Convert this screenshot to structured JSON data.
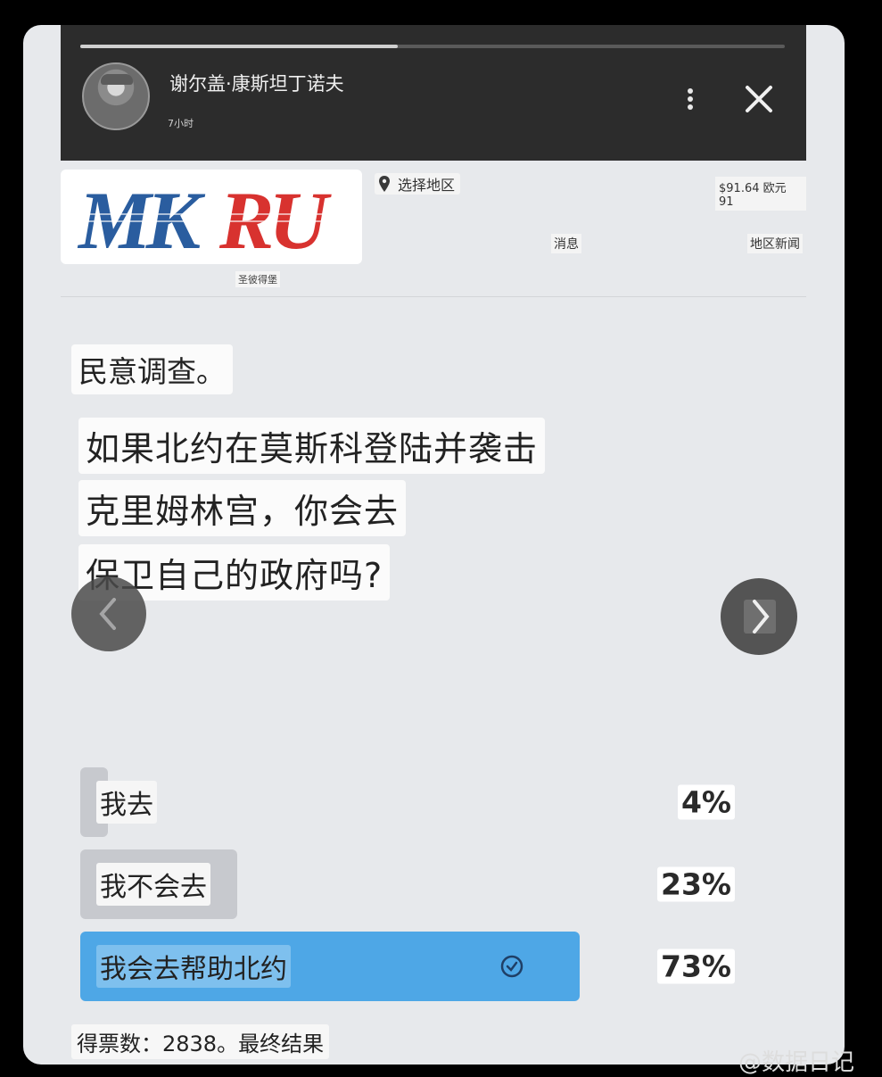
{
  "story": {
    "author": "谢尔盖·康斯坦丁诺夫",
    "time": "7小时",
    "progress": 0.45
  },
  "site": {
    "logo_text": "MKRU",
    "logo_caption": "圣彼得堡",
    "region": "选择地区",
    "currency": "$91.64 欧元 91",
    "nav_news": "消息",
    "nav_regional": "地区新闻"
  },
  "survey": {
    "title": "民意调查。",
    "question_lines": [
      "如果北约在莫斯科登陆并袭击",
      "克里姆林宫，你会去",
      "保卫自己的政府吗?"
    ],
    "options": [
      {
        "label": "我去",
        "percent": "4%",
        "value": 4,
        "selected": false
      },
      {
        "label": "我不会去",
        "percent": "23%",
        "value": 23,
        "selected": false
      },
      {
        "label": "我会去帮助北约",
        "percent": "73%",
        "value": 73,
        "selected": true
      }
    ],
    "footer": "得票数：2838。最终结果"
  },
  "watermark": "@数据日记",
  "colors": {
    "selected_bar": "#4ea7e6",
    "unselected_bar": "#c7c9ce",
    "header_bg": "#2c2c2c",
    "logo_blue": "#2a5d9f",
    "logo_red": "#d8322f"
  }
}
